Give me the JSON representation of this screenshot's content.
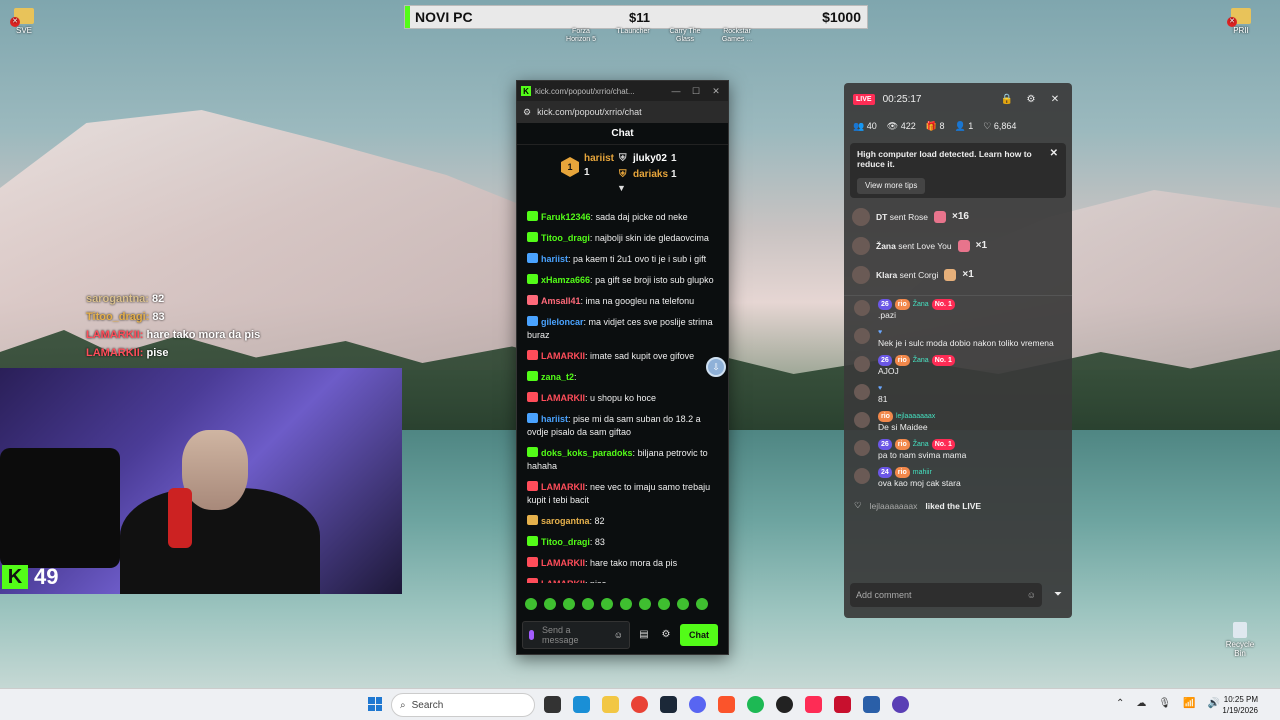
{
  "desktop": {
    "icon_left_label": "SVE",
    "icon_right_label": "PRII",
    "recycle_label": "Recycle Bin"
  },
  "goal": {
    "title": "NOVI PC",
    "current": "$11",
    "target": "$1000",
    "labels": [
      "Forza Horizon 5",
      "TLauncher",
      "Carry The Glass",
      "Rockstar Games ..."
    ]
  },
  "overlay_chat": [
    {
      "name": "sarogantna:",
      "text": "82"
    },
    {
      "name": "Titoo_dragi:",
      "text": "83"
    },
    {
      "name": "LAMARKII:",
      "text": "hare tako mora da pis"
    },
    {
      "name": "LAMARKII:",
      "text": "pise"
    }
  ],
  "cam": {
    "viewers": "49"
  },
  "kick": {
    "window_title": "kick.com/popout/xrrio/chat...",
    "url": "kick.com/popout/xrrio/chat",
    "header": "Chat",
    "leader1_name": "hariist",
    "leader1_count": "1",
    "leader2_name": "jluky02",
    "leader2_count": "1",
    "leader3_name": "dariaks",
    "leader3_count": "1",
    "messages": [
      {
        "user": "Faruk12346",
        "text": "sada daj picke od neke",
        "color": "#53fc18"
      },
      {
        "user": "Titoo_dragi",
        "text": "najbolji skin ide gledaovcima",
        "color": "#53fc18"
      },
      {
        "user": "hariist",
        "text": "pa kaem ti 2u1 ovo ti je i sub i gift",
        "color": "#4aa3ff"
      },
      {
        "user": "xHamza666",
        "text": "pa gift se broji isto sub glupko",
        "color": "#53fc18"
      },
      {
        "user": "Amsall41",
        "text": "ima na googleu na telefonu",
        "color": "#ff6a7a"
      },
      {
        "user": "gileloncar",
        "text": "ma vidjet ces sve poslije strima buraz",
        "color": "#4aa3ff"
      },
      {
        "user": "LAMARKII",
        "text": "imate sad kupit ove gifove",
        "color": "#ff4d5a"
      },
      {
        "user": "zana_t2",
        "text": "",
        "color": "#53fc18"
      },
      {
        "user": "LAMARKII",
        "text": "u shopu ko hoce",
        "color": "#ff4d5a"
      },
      {
        "user": "hariist",
        "text": "pise mi da sam suban do 18.2 a ovdje pisalo da sam giftao",
        "color": "#4aa3ff"
      },
      {
        "user": "doks_koks_paradoks",
        "text": "biljana petrovic to hahaha",
        "color": "#53fc18"
      },
      {
        "user": "LAMARKII",
        "text": "nee vec to imaju samo trebaju kupit i tebi bacit",
        "color": "#ff4d5a"
      },
      {
        "user": "sarogantna",
        "text": "82",
        "color": "#e6b14c"
      },
      {
        "user": "Titoo_dragi",
        "text": "83",
        "color": "#53fc18"
      },
      {
        "user": "LAMARKII",
        "text": "hare tako mora da pis",
        "color": "#ff4d5a"
      },
      {
        "user": "LAMARKII",
        "text": "pise",
        "color": "#ff4d5a"
      }
    ],
    "input_placeholder": "Send a message",
    "chat_button": "Chat"
  },
  "live": {
    "badge": "LIVE",
    "timer": "00:25:17",
    "stats": {
      "a": "40",
      "b": "422",
      "c": "8",
      "d": "1",
      "e": "6,864"
    },
    "warning": "High computer load detected. Learn how to reduce it.",
    "tips_button": "View more tips",
    "gifts": [
      {
        "user": "DT",
        "action": "sent Rose",
        "mult": "×16"
      },
      {
        "user": "Žana",
        "action": "sent Love You",
        "mult": "×1"
      },
      {
        "user": "Klara",
        "action": "sent Corgi",
        "mult": "×1"
      }
    ],
    "comments": [
      {
        "lv": "26",
        "rio": "rio",
        "name": "Žana",
        "no": "No. 1",
        "text": ".pazi"
      },
      {
        "lv": "",
        "rio": "",
        "name": "",
        "no": "",
        "text": "Nek je i sulc moda dobio nakon toliko vremena"
      },
      {
        "lv": "26",
        "rio": "rio",
        "name": "Žana",
        "no": "No. 1",
        "text": "AJOJ"
      },
      {
        "lv": "",
        "rio": "",
        "name": "",
        "no": "",
        "text": "81"
      },
      {
        "lv": "",
        "rio": "rio",
        "name": "lejlaaaaaaax",
        "no": "",
        "text": "De si Maidee"
      },
      {
        "lv": "26",
        "rio": "rio",
        "name": "Žana",
        "no": "No. 1",
        "text": "pa to nam svima mama"
      },
      {
        "lv": "24",
        "rio": "rio",
        "name": "mahiir",
        "no": "",
        "text": "ova kao moj cak stara"
      }
    ],
    "liked_user": "lejlaaaaaaax",
    "liked_text": "liked the LIVE",
    "add_comment": "Add comment"
  },
  "taskbar": {
    "search": "Search",
    "time": "10:25 PM",
    "date": "1/19/2026"
  }
}
